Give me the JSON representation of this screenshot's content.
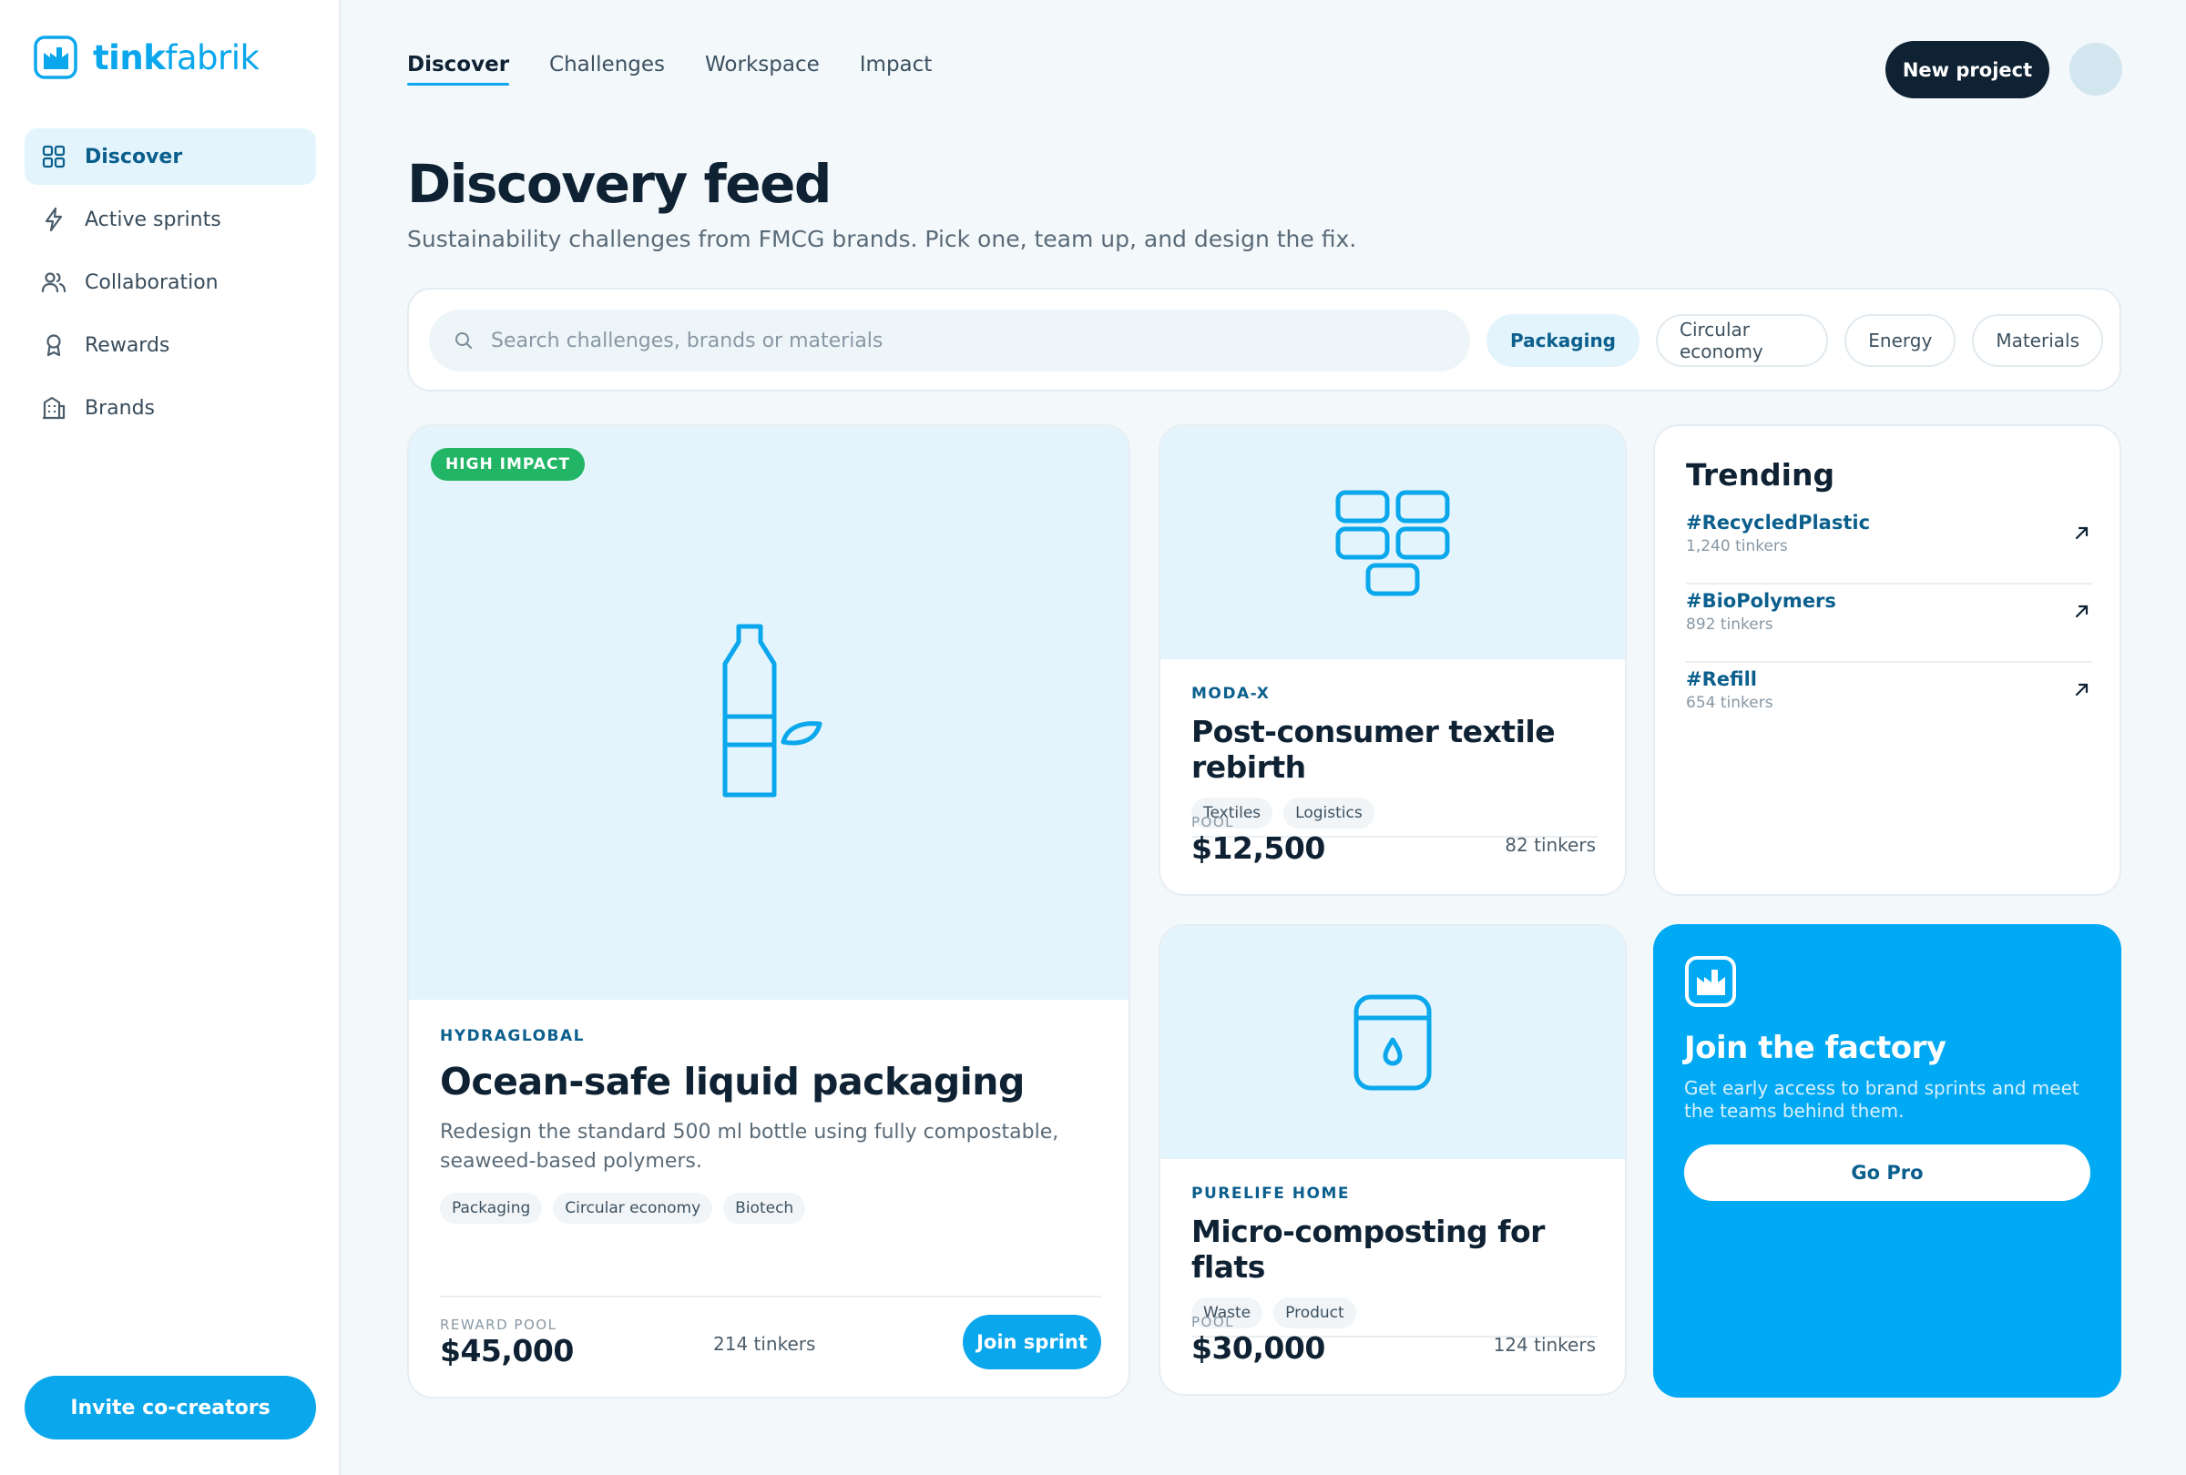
{
  "app": {
    "brand_prefix": "tink",
    "brand_suffix": "fabrik",
    "accent_color": "#0aa7ec",
    "dark_color": "#0f2233",
    "success_color": "#22b566"
  },
  "sidebar": {
    "items": [
      {
        "label": "Discover",
        "icon": "grid-icon",
        "active": true
      },
      {
        "label": "Active sprints",
        "icon": "lightning-icon",
        "active": false
      },
      {
        "label": "Collaboration",
        "icon": "users-icon",
        "active": false
      },
      {
        "label": "Rewards",
        "icon": "award-icon",
        "active": false
      },
      {
        "label": "Brands",
        "icon": "building-icon",
        "active": false
      }
    ],
    "invite_label": "Invite co-creators"
  },
  "topnav": {
    "tabs": [
      {
        "label": "Discover",
        "active": true
      },
      {
        "label": "Challenges",
        "active": false
      },
      {
        "label": "Workspace",
        "active": false
      },
      {
        "label": "Impact",
        "active": false
      }
    ],
    "new_project_label": "New project"
  },
  "page": {
    "title": "Discovery feed",
    "subtitle": "Sustainability challenges from FMCG brands. Pick one, team up, and design the fix."
  },
  "search": {
    "placeholder": "Search challenges, brands or materials",
    "value": "",
    "filters": [
      {
        "label": "Packaging",
        "active": true
      },
      {
        "label": "Circular economy",
        "active": false
      },
      {
        "label": "Energy",
        "active": false
      },
      {
        "label": "Materials",
        "active": false
      }
    ]
  },
  "featured": {
    "badge": "HIGH IMPACT",
    "icon": "bottle-leaf-icon",
    "brand": "HYDRAGLOBAL",
    "title": "Ocean-safe liquid packaging",
    "description": "Redesign the standard 500 ml bottle using fully compostable, seaweed-based polymers.",
    "tags": [
      "Packaging",
      "Circular economy",
      "Biotech"
    ],
    "pool_label": "REWARD POOL",
    "pool": "$45,000",
    "tinkers": "214 tinkers",
    "cta": "Join sprint"
  },
  "textile": {
    "icon": "bricks-icon",
    "brand": "MODA-X",
    "title": "Post-consumer textile rebirth",
    "tags": [
      "Textiles",
      "Logistics"
    ],
    "pool_label": "POOL",
    "pool": "$12,500",
    "tinkers": "82 tinkers"
  },
  "compost": {
    "icon": "compost-bin-icon",
    "brand": "PURELIFE HOME",
    "title": "Micro-composting for flats",
    "tags": [
      "Waste",
      "Product"
    ],
    "pool_label": "POOL",
    "pool": "$30,000",
    "tinkers": "124 tinkers"
  },
  "trending": {
    "title": "Trending",
    "items": [
      {
        "tag": "#RecycledPlastic",
        "count": "1,240 tinkers"
      },
      {
        "tag": "#BioPolymers",
        "count": "892 tinkers"
      },
      {
        "tag": "#Refill",
        "count": "654 tinkers"
      }
    ]
  },
  "promo": {
    "title": "Join the factory",
    "description": "Get early access to brand sprints and meet the teams behind them.",
    "cta": "Go Pro"
  }
}
